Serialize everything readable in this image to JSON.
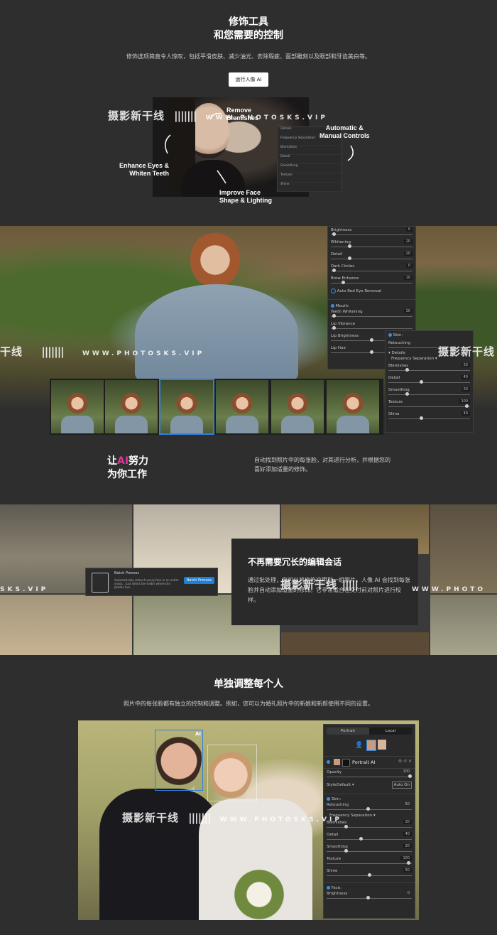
{
  "section1": {
    "title_line1": "修饰工具",
    "title_line2": "和您需要的控制",
    "subtitle": "修饰选项简直令人惊叹，包括平滑皮肤、减少油光、去除瑕疵、面部雕刻以及眼部和牙齿美白等。",
    "button_label": "运行人像 AI",
    "annotations": {
      "remove_blemishes": "Remove\nBlemishes",
      "auto_manual": "Automatic &\nManual Controls",
      "enhance_eyes": "Enhance Eyes &\nWhiten Teeth",
      "improve_face": "Improve Face\nShape & Lighting"
    },
    "mini_panel": {
      "rows": [
        "Details",
        "Frequency Separation",
        "Blemishes",
        "Detail",
        "Smoothing",
        "Texture",
        "Shine"
      ]
    }
  },
  "watermark": {
    "text": "摄影新干线",
    "url": "WWW.PHOTOSKS.VIP"
  },
  "section2": {
    "face_panel": {
      "rows": [
        {
          "label": "Brightness",
          "value": "0",
          "knob": 0.02
        },
        {
          "label": "Whitening",
          "value": "20",
          "knob": 0.22
        },
        {
          "label": "Detail",
          "value": "20",
          "knob": 0.22
        },
        {
          "label": "Dark Circles",
          "value": "0",
          "knob": 0.02
        },
        {
          "label": "Brow Enhance",
          "value": "10",
          "knob": 0.14
        }
      ],
      "red_eye_label": "Auto Red Eye Removal",
      "mouth_label": "Mouth:",
      "mouth_rows": [
        {
          "label": "Teeth Whitening",
          "value": "30",
          "knob": 0.02
        },
        {
          "label": "Lip Vibrance",
          "value": "",
          "knob": 0.02
        },
        {
          "label": "Lip Brightness",
          "value": "",
          "knob": 0.5
        },
        {
          "label": "Lip Hue",
          "value": "",
          "knob": 0.5
        }
      ]
    },
    "skin_panel": {
      "title": "Skin:",
      "retouching_label": "Retouching",
      "details_label": "Details",
      "freq_sep_label": "Frequency Separation",
      "rows": [
        {
          "label": "Blemishes",
          "value": "20",
          "knob": 0.22
        },
        {
          "label": "Detail",
          "value": "40",
          "knob": 0.4
        },
        {
          "label": "Smoothing",
          "value": "20",
          "knob": 0.22
        },
        {
          "label": "Texture",
          "value": "100",
          "knob": 0.98
        },
        {
          "label": "Shine",
          "value": "40",
          "knob": 0.4
        }
      ]
    }
  },
  "section3": {
    "title_part1": "让",
    "title_ai": "AI",
    "title_part2": "努力",
    "title_line2": "为你工作",
    "description": "自动找到照片中的每张脸，对其进行分析，并根据您的喜好添加适量的修饰。",
    "ai_color": "#e0359b"
  },
  "section4": {
    "card_title": "不再需要冗长的编辑会话",
    "card_body": "通过批处理，您可以将修饰应用到一组照片，人像 AI 会找到每张脸并自动添加适量的修饰。它非常适合在交付前对照片进行校样。",
    "batch_title": "Batch Process",
    "batch_desc": "Automatically retouch every face in an entire shoot... Just select the folder where the photos live.",
    "batch_button": "Batch Process"
  },
  "section5": {
    "title": "单独调整每个人",
    "subtitle": "照片中的每张脸都有独立的控制和调整。例如，您可以为婚礼照片中的新娘和新郎使用不同的设置。",
    "ai_badge": "AI",
    "panel": {
      "tab_portrait": "Portrait",
      "tab_local": "Local",
      "layer_name": "Portrait AI",
      "opacity_label": "Opacity",
      "opacity_value": "100",
      "style_label": "Style",
      "style_value": "Default",
      "auto_on": "Auto On",
      "skin_label": "Skin:",
      "retouching_label": "Retouching",
      "retouching_value": "50",
      "freq_sep_label": "Frequency Separation",
      "rows": [
        {
          "label": "Blemishes",
          "value": "20",
          "knob": 0.22
        },
        {
          "label": "Detail",
          "value": "40",
          "knob": 0.4
        },
        {
          "label": "Smoothing",
          "value": "20",
          "knob": 0.22
        },
        {
          "label": "Texture",
          "value": "100",
          "knob": 0.98
        },
        {
          "label": "Shine",
          "value": "50",
          "knob": 0.5
        }
      ],
      "face_label": "Face:",
      "brightness_label": "Brightness",
      "brightness_value": "0"
    }
  }
}
